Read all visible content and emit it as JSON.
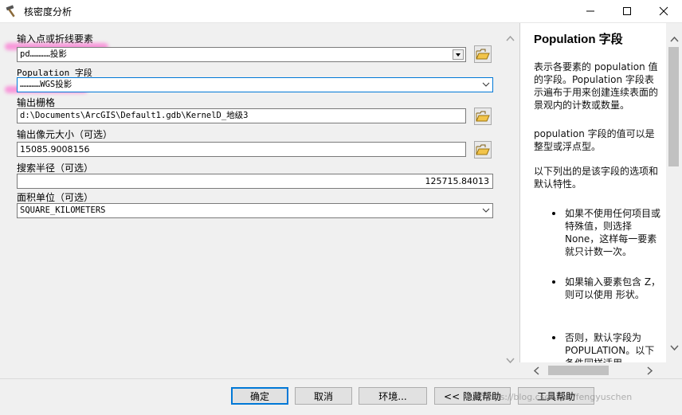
{
  "window": {
    "title": "核密度分析",
    "minimize": "—",
    "maximize": "☐",
    "close": "✕"
  },
  "form": {
    "input_features_label": "输入点或折线要素",
    "input_features_value": "pd…………投影",
    "population_label": "Population 字段",
    "population_value": "…………WGS投影",
    "output_raster_label": "输出栅格",
    "output_raster_value": "d:\\Documents\\ArcGIS\\Default1.gdb\\KernelD_地级3",
    "cell_size_label": "输出像元大小（可选）",
    "cell_size_value": "15085.9008156",
    "search_radius_label": "搜索半径（可选）",
    "search_radius_value": "125715.84013",
    "area_units_label": "面积单位（可选）",
    "area_units_value": "SQUARE_KILOMETERS"
  },
  "help": {
    "title": "Population 字段",
    "para1": "表示各要素的 population 值的字段。Population 字段表示遍布于用来创建连续表面的景观内的计数或数量。",
    "para2": "population 字段的值可以是整型或浮点型。",
    "para3": "以下列出的是该字段的选项和默认特性。",
    "bullet1": "如果不使用任何项目或特殊值，则选择 None，这样每一要素就只计数一次。",
    "bullet2": "如果输入要素包含 Z，则可以使用 形状。",
    "bullet3": "否则，默认字段为 POPULATION。以下条件同样适用。"
  },
  "buttons": {
    "ok": "确定",
    "cancel": "取消",
    "environments": "环境...",
    "hide_help": "<< 隐藏帮助",
    "tool_help": "工具帮助"
  },
  "watermark": "https://blog.csdn.net/fengyuschen"
}
